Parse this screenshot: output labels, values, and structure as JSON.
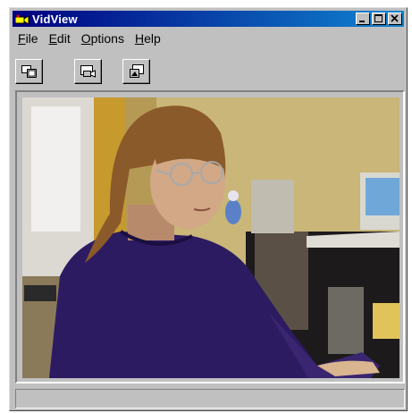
{
  "window": {
    "title": "VidView",
    "icon": "vidview-app-icon"
  },
  "title_buttons": {
    "minimize_icon": "minimize-icon",
    "maximize_icon": "maximize-icon",
    "close_icon": "close-icon"
  },
  "menu": {
    "items": [
      {
        "label": "File",
        "accel": "F",
        "rest": "ile"
      },
      {
        "label": "Edit",
        "accel": "E",
        "rest": "dit"
      },
      {
        "label": "Options",
        "accel": "O",
        "rest": "ptions"
      },
      {
        "label": "Help",
        "accel": "H",
        "rest": "elp"
      }
    ]
  },
  "toolbar": {
    "buttons": [
      {
        "icon": "capture-frame-icon"
      },
      {
        "icon": "video-camera-icon"
      },
      {
        "icon": "snapshot-icon"
      }
    ]
  },
  "video": {
    "description_icon": "live-video-feed"
  },
  "status": {
    "text": ""
  },
  "colors": {
    "titlebar_start": "#000080",
    "titlebar_end": "#1084d0",
    "chrome": "#c0c0c0"
  }
}
